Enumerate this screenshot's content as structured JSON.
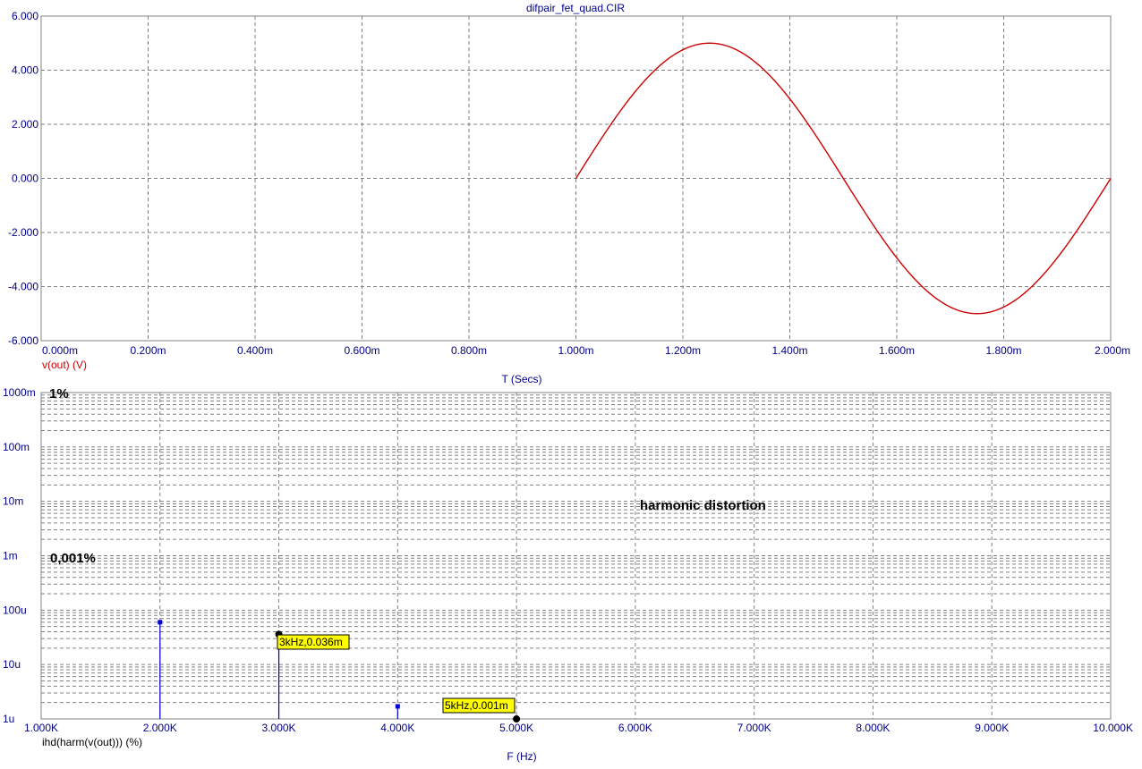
{
  "window": {
    "title": "difpair_fet_quad.CIR"
  },
  "colors": {
    "axis_text": "#00008b",
    "waveform": "#cc0000",
    "harmonic_bars": "#0000cc",
    "grid": "#808080",
    "tag_bg": "#ffff00"
  },
  "chart_data": [
    {
      "type": "line",
      "title": "difpair_fet_quad.CIR",
      "xlabel": "T (Secs)",
      "ylabel": "",
      "xlim": [
        0,
        2.0
      ],
      "ylim": [
        -6,
        6
      ],
      "x_unit": "ms",
      "x_ticks": [
        0,
        0.2,
        0.4,
        0.6,
        0.8,
        1.0,
        1.2,
        1.4,
        1.6,
        1.8,
        2.0
      ],
      "x_tick_labels": [
        "0.000m",
        "0.200m",
        "0.400m",
        "0.600m",
        "0.800m",
        "1.000m",
        "1.200m",
        "1.400m",
        "1.600m",
        "1.800m",
        "2.000m"
      ],
      "y_ticks": [
        6,
        4,
        2,
        0,
        -2,
        -4,
        -6
      ],
      "y_tick_labels": [
        "6.000",
        "4.000",
        "2.000",
        "0.000",
        "-2.000",
        "-4.000",
        "-6.000"
      ],
      "grid": true,
      "series": [
        {
          "name": "v(out) (V)",
          "color": "#cc0000",
          "x": [
            1.0,
            1.025,
            1.05,
            1.075,
            1.1,
            1.125,
            1.15,
            1.175,
            1.2,
            1.225,
            1.25,
            1.275,
            1.3,
            1.325,
            1.35,
            1.375,
            1.4,
            1.425,
            1.45,
            1.475,
            1.5,
            1.525,
            1.55,
            1.575,
            1.6,
            1.625,
            1.65,
            1.675,
            1.7,
            1.725,
            1.75,
            1.775,
            1.8,
            1.825,
            1.85,
            1.875,
            1.9,
            1.925,
            1.95,
            1.975,
            2.0
          ],
          "y": [
            0,
            0.782,
            1.545,
            2.27,
            2.939,
            3.536,
            4.045,
            4.455,
            4.755,
            4.938,
            5.0,
            4.938,
            4.755,
            4.455,
            4.045,
            3.536,
            2.939,
            2.27,
            1.545,
            0.782,
            0,
            -0.782,
            -1.545,
            -2.27,
            -2.939,
            -3.536,
            -4.045,
            -4.455,
            -4.755,
            -4.938,
            -5.0,
            -4.938,
            -4.755,
            -4.455,
            -4.045,
            -3.536,
            -2.939,
            -2.27,
            -1.545,
            -0.782,
            0
          ]
        }
      ]
    },
    {
      "type": "bar",
      "title": "",
      "xlabel": "F (Hz)",
      "ylabel": "",
      "xlim": [
        1000,
        10000
      ],
      "ylim": [
        1e-06,
        1
      ],
      "y_scale": "log",
      "x_ticks": [
        1000,
        2000,
        3000,
        4000,
        5000,
        6000,
        7000,
        8000,
        9000,
        10000
      ],
      "x_tick_labels": [
        "1.000K",
        "2.000K",
        "3.000K",
        "4.000K",
        "5.000K",
        "6.000K",
        "7.000K",
        "8.000K",
        "9.000K",
        "10.000K"
      ],
      "y_ticks": [
        1,
        0.1,
        0.01,
        0.001,
        0.0001,
        1e-05,
        1e-06
      ],
      "y_tick_labels": [
        "1000m",
        "100m",
        "10m",
        "1m",
        "100u",
        "10u",
        "1u"
      ],
      "grid": true,
      "series": [
        {
          "name": "ihd(harm(v(out))) (%)",
          "color": "#0000cc",
          "x": [
            2000,
            3000,
            4000,
            5000
          ],
          "y": [
            6e-05,
            3.6e-05,
            1.7e-06,
            1e-06
          ]
        }
      ],
      "annotations": {
        "one_percent": "1%",
        "point_001_percent": "0,001%",
        "label": "harmonic distortion",
        "tag_3k": "3kHz,0.036m",
        "tag_5k": "5kHz,0.001m"
      }
    }
  ]
}
